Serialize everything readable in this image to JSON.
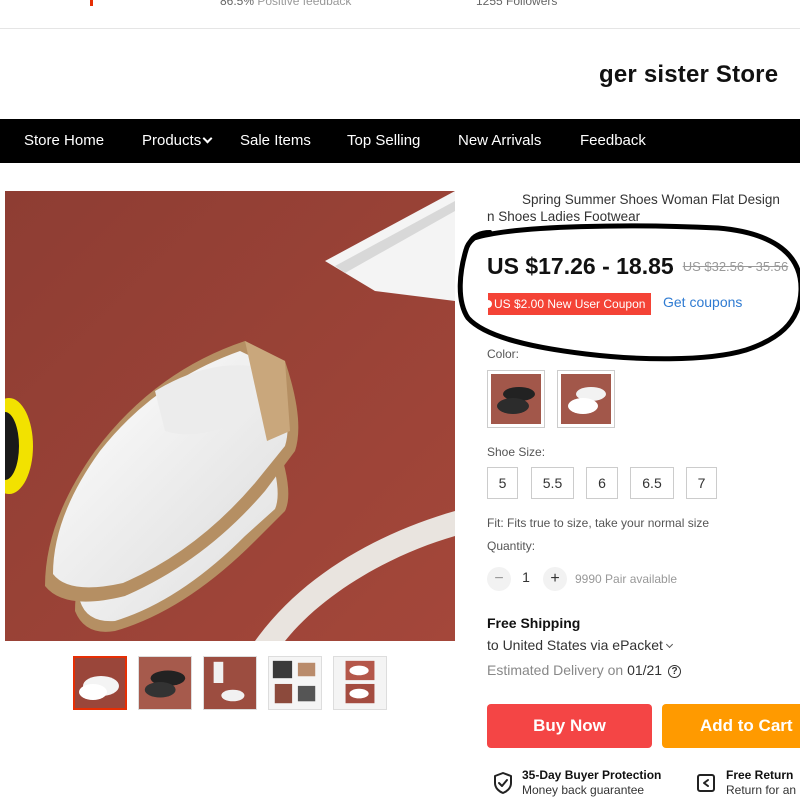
{
  "top_strip": {
    "feedback_percent": "86.5%",
    "feedback_label": "Positive feedback",
    "followers": "1255 Followers"
  },
  "store": {
    "name": "ger sister Store"
  },
  "nav": {
    "items": [
      {
        "label": "Store Home"
      },
      {
        "label": "Products",
        "dropdown": true
      },
      {
        "label": "Sale Items"
      },
      {
        "label": "Top Selling"
      },
      {
        "label": "New Arrivals"
      },
      {
        "label": "Feedback"
      }
    ]
  },
  "product": {
    "title_line1": "Spring Summer Shoes Woman Flat Design",
    "title_line2": "n Shoes Ladies Footwear",
    "price": "US $17.26 - 18.85",
    "old_price": "US $32.56 - 35.56",
    "coupon": "US $2.00 New User Coupon",
    "get_coupons": "Get coupons",
    "color_label": "Color:",
    "colors": [
      {
        "name": "black",
        "selected": false
      },
      {
        "name": "white",
        "selected": true
      }
    ],
    "size_label": "Shoe Size:",
    "sizes": [
      "5",
      "5.5",
      "6",
      "6.5",
      "7"
    ],
    "fit": "Fit: Fits true to size, take your normal size",
    "quantity_label": "Quantity:",
    "quantity": "1",
    "minus": "−",
    "plus": "+",
    "available": "9990 Pair available"
  },
  "shipping": {
    "title": "Free Shipping",
    "destination": "to United States via ePacket",
    "delivery_label": "Estimated Delivery on",
    "delivery_date": "01/21",
    "help": "?"
  },
  "actions": {
    "buy_now": "Buy Now",
    "add_to_cart": "Add to Cart"
  },
  "protection": {
    "p1_title": "35-Day Buyer Protection",
    "p1_sub": "Money back guarantee",
    "p2_title": "Free Return",
    "p2_sub": "Return for an"
  },
  "colors": {
    "nav_bg": "#000000",
    "buy_now": "#f44545",
    "add_to_cart": "#ff9a00",
    "coupon": "#f44336",
    "link": "#2f7bd2"
  }
}
